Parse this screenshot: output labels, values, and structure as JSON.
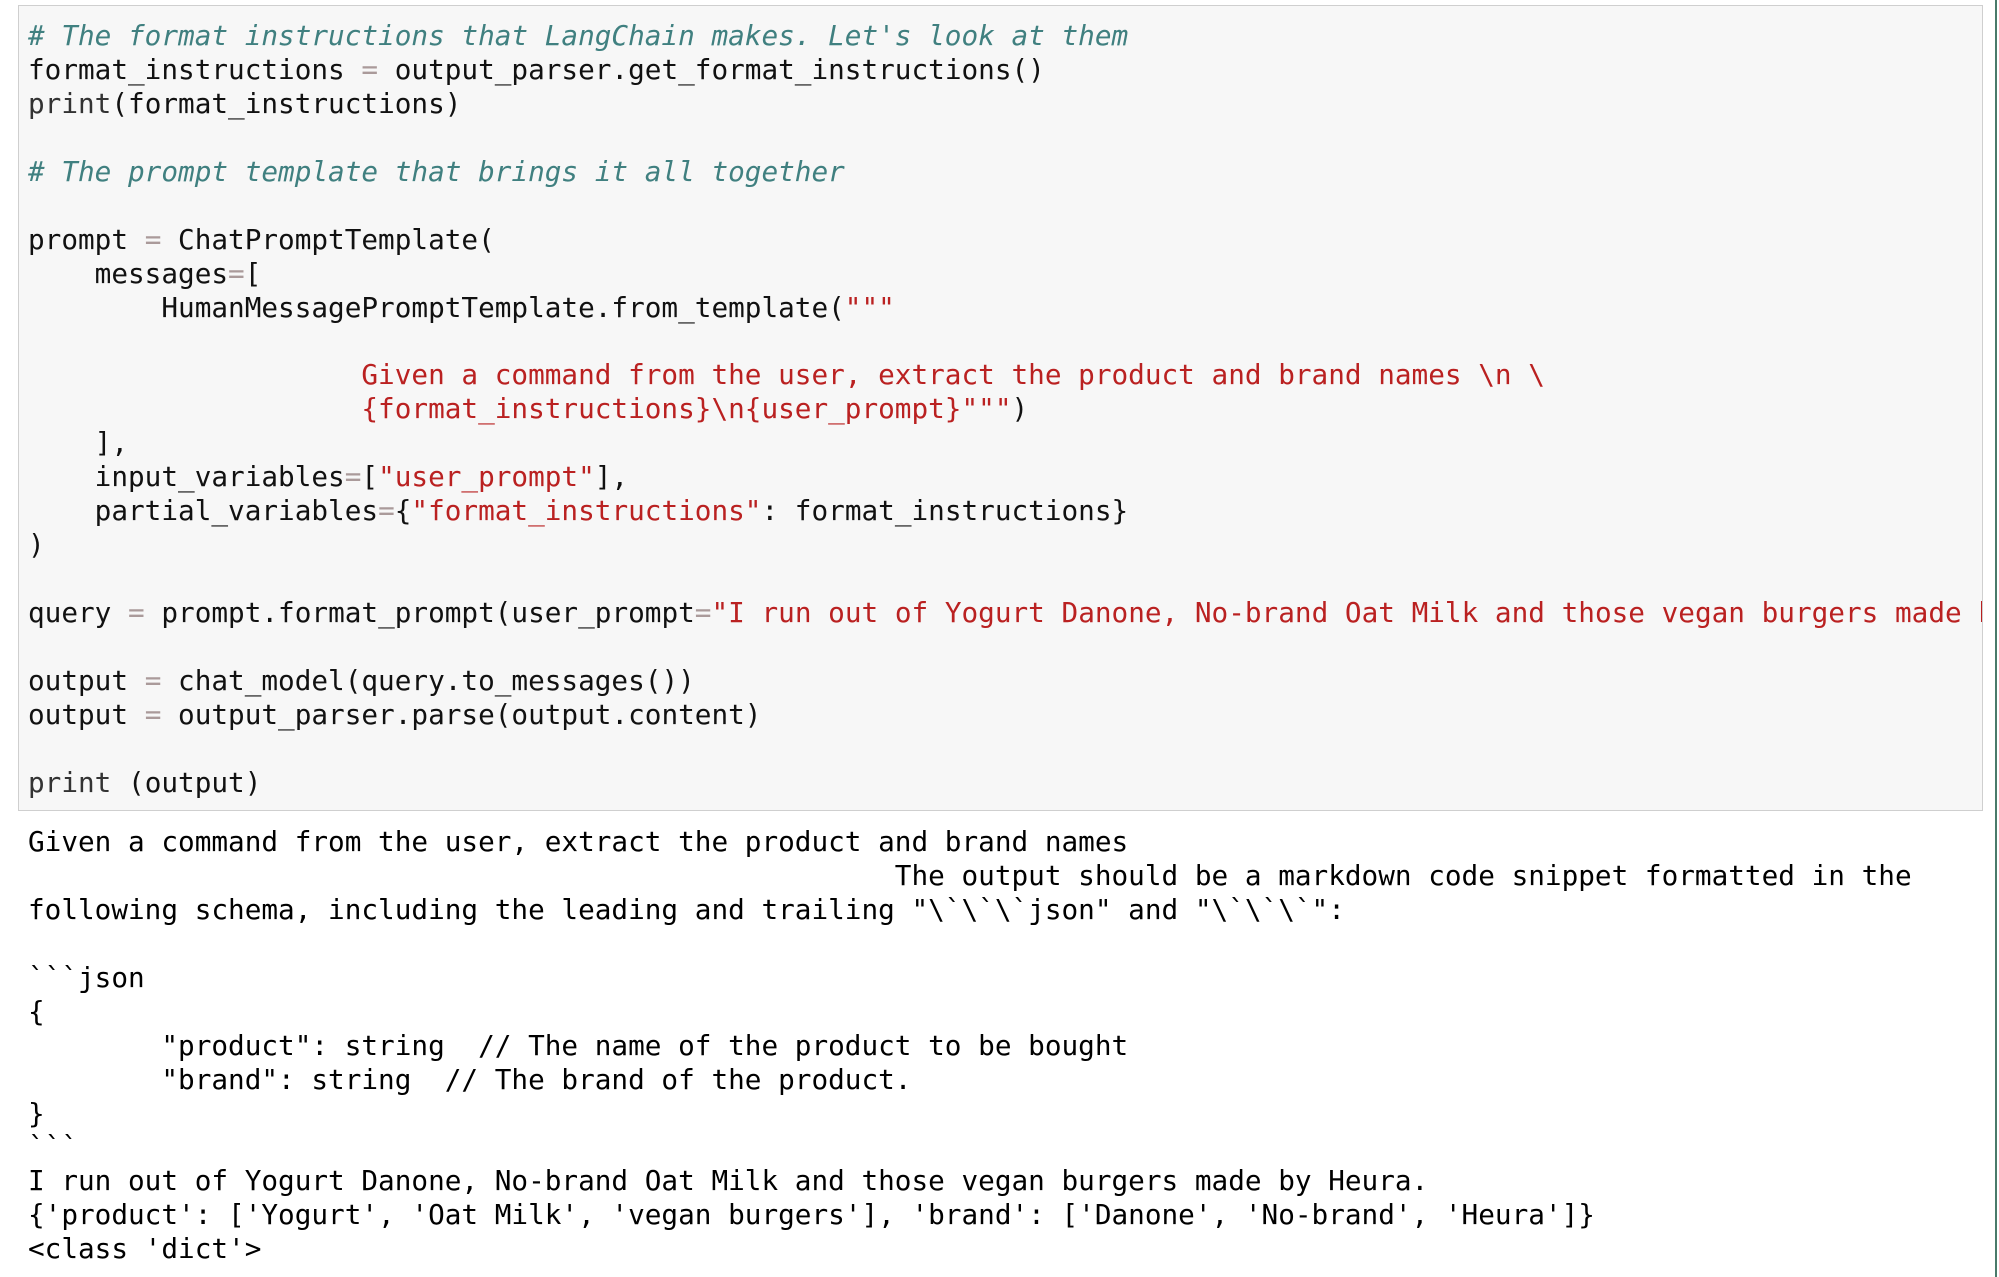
{
  "input_cell": {
    "code_lines": [
      [
        [
          "# The format instructions that LangChain makes. Let's look at them",
          "comment"
        ]
      ],
      [
        [
          "format_instructions ",
          "plain"
        ],
        [
          "=",
          "op"
        ],
        [
          " output_parser.get_format_instructions()",
          "plain"
        ]
      ],
      [
        [
          "print",
          "builtin"
        ],
        [
          "(format_instructions)",
          "plain"
        ]
      ],
      [],
      [
        [
          "# The prompt template that brings it all together",
          "comment"
        ]
      ],
      [],
      [
        [
          "prompt ",
          "plain"
        ],
        [
          "=",
          "op"
        ],
        [
          " ChatPromptTemplate(",
          "plain"
        ]
      ],
      [
        [
          "    messages",
          "plain"
        ],
        [
          "=",
          "op"
        ],
        [
          "[",
          "plain"
        ]
      ],
      [
        [
          "        HumanMessagePromptTemplate.from_template(",
          "plain"
        ],
        [
          "\"\"\"",
          "string"
        ]
      ],
      [],
      [
        [
          "                    Given a command from the user, extract the product and brand names \\n \\",
          "string"
        ]
      ],
      [
        [
          "                    {format_instructions}\\n{user_prompt}\"\"\"",
          "string"
        ],
        [
          ")",
          "plain"
        ]
      ],
      [
        [
          "    ],",
          "plain"
        ]
      ],
      [
        [
          "    input_variables",
          "plain"
        ],
        [
          "=",
          "op"
        ],
        [
          "[",
          "plain"
        ],
        [
          "\"user_prompt\"",
          "string"
        ],
        [
          "],",
          "plain"
        ]
      ],
      [
        [
          "    partial_variables",
          "plain"
        ],
        [
          "=",
          "op"
        ],
        [
          "{",
          "plain"
        ],
        [
          "\"format_instructions\"",
          "string"
        ],
        [
          ": format_instructions}",
          "plain"
        ]
      ],
      [
        [
          ")",
          "plain"
        ]
      ],
      [],
      [
        [
          "query ",
          "plain"
        ],
        [
          "=",
          "op"
        ],
        [
          " prompt.format_prompt(user_prompt",
          "plain"
        ],
        [
          "=",
          "op"
        ],
        [
          "\"I run out of Yogurt Danone, No-brand Oat Milk and those vegan burgers made by Heura.\"",
          "string"
        ],
        [
          ")",
          "plain"
        ]
      ],
      [],
      [
        [
          "output ",
          "plain"
        ],
        [
          "=",
          "op"
        ],
        [
          " chat_model(query.to_messages())",
          "plain"
        ]
      ],
      [
        [
          "output ",
          "plain"
        ],
        [
          "=",
          "op"
        ],
        [
          " output_parser.parse(output.content)",
          "plain"
        ]
      ],
      [],
      [
        [
          "print",
          "builtin"
        ],
        [
          " (output)",
          "plain"
        ]
      ]
    ]
  },
  "output_cell": {
    "lines": [
      "Given a command from the user, extract the product and brand names",
      "                                                    The output should be a markdown code snippet formatted in the",
      "following schema, including the leading and trailing \"\\`\\`\\`json\" and \"\\`\\`\\`\":",
      "",
      "```json",
      "{",
      "        \"product\": string  // The name of the product to be bought",
      "        \"brand\": string  // The brand of the product.",
      "}",
      "```",
      "I run out of Yogurt Danone, No-brand Oat Milk and those vegan burgers made by Heura.",
      "{'product': ['Yogurt', 'Oat Milk', 'vegan burgers'], 'brand': ['Danone', 'No-brand', 'Heura']}",
      "<class 'dict'>"
    ]
  },
  "colors": {
    "comment": "#408080",
    "string": "#ba2121",
    "cell_bg": "#f7f7f7"
  }
}
